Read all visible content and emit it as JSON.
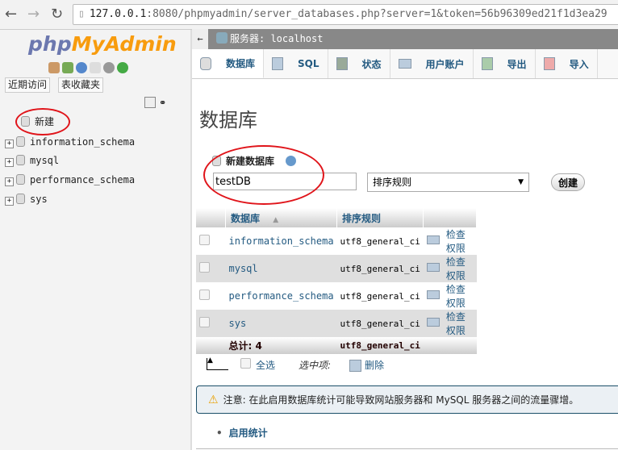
{
  "browser": {
    "url_host": "127.0.0.1",
    "url_rest": ":8080/phpmyadmin/server_databases.php?server=1&token=56b96309ed21f1d3ea29"
  },
  "sidebar": {
    "logo_a": "php",
    "logo_b": "MyAdmin",
    "recent": "近期访问",
    "favorites": "表收藏夹",
    "new": "新建",
    "databases": [
      "information_schema",
      "mysql",
      "performance_schema",
      "sys"
    ]
  },
  "server_bar": {
    "label": "服务器: localhost"
  },
  "tabs": [
    {
      "label": "数据库"
    },
    {
      "label": "SQL"
    },
    {
      "label": "状态"
    },
    {
      "label": "用户账户"
    },
    {
      "label": "导出"
    },
    {
      "label": "导入"
    }
  ],
  "main": {
    "title": "数据库",
    "create_label": "新建数据库",
    "db_name_value": "testDB",
    "collation_placeholder": "排序规则",
    "create_button": "创建",
    "table": {
      "headers": [
        "数据库",
        "排序规则"
      ],
      "rows": [
        {
          "name": "information_schema",
          "collation": "utf8_general_ci",
          "action": "检查权限"
        },
        {
          "name": "mysql",
          "collation": "utf8_general_ci",
          "action": "检查权限"
        },
        {
          "name": "performance_schema",
          "collation": "utf8_general_ci",
          "action": "检查权限"
        },
        {
          "name": "sys",
          "collation": "utf8_general_ci",
          "action": "检查权限"
        }
      ],
      "total_label": "总计: 4",
      "total_collation": "utf8_general_ci"
    },
    "select_all": "全选",
    "with_selected": "选中项:",
    "delete": "删除",
    "notice": "注意: 在此启用数据库统计可能导致网站服务器和 MySQL 服务器之间的流量骤增。",
    "enable_stats": "启用统计"
  }
}
